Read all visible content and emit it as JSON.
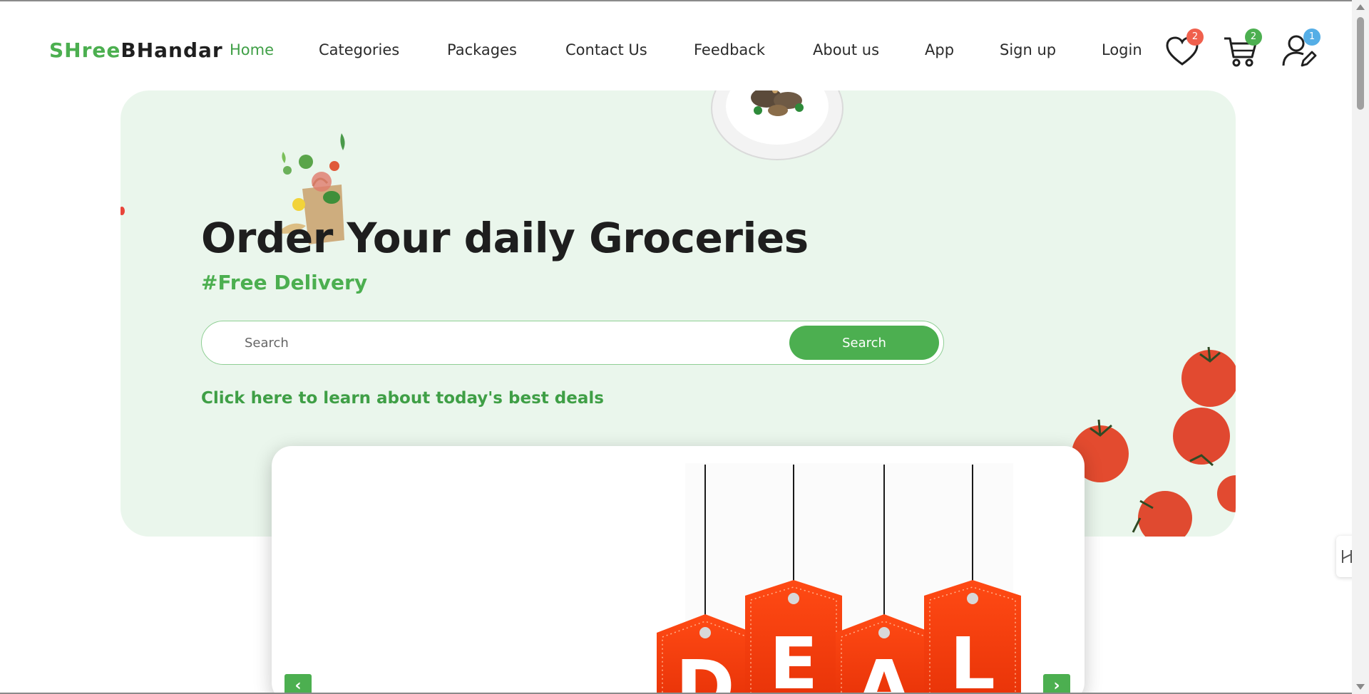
{
  "brand": {
    "part1": "SHree",
    "part2": "BHandar"
  },
  "nav": {
    "items": [
      {
        "label": "Home",
        "active": true
      },
      {
        "label": "Categories"
      },
      {
        "label": "Packages"
      },
      {
        "label": "Contact Us"
      },
      {
        "label": "Feedback"
      },
      {
        "label": "About us"
      },
      {
        "label": "App"
      },
      {
        "label": "Sign up"
      },
      {
        "label": "Login"
      }
    ]
  },
  "header_icons": {
    "wishlist": {
      "icon": "heart-icon",
      "count": "2",
      "badge_color": "#f0604d"
    },
    "cart": {
      "icon": "cart-icon",
      "count": "2",
      "badge_color": "#4caf50"
    },
    "profile": {
      "icon": "user-edit-icon",
      "count": "1",
      "badge_color": "#55aee6"
    }
  },
  "hero": {
    "title": "Order Your daily Groceries",
    "subtitle": "#Free Delivery",
    "search_placeholder": "Search",
    "search_button": "Search",
    "deals_link": "Click here to learn about today's best deals"
  },
  "deal_banner": {
    "letters": [
      "D",
      "E",
      "A",
      "L"
    ],
    "prev_label": "‹",
    "next_label": "›"
  },
  "colors": {
    "accent": "#4caf50",
    "hero_bg": "#eaf6ec",
    "tag_red": "#ff3d0f"
  }
}
